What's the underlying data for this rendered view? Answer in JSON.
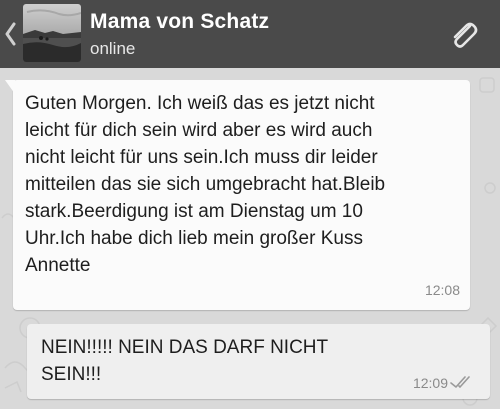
{
  "header": {
    "contact_name": "Mama von Schatz",
    "status": "online",
    "back_icon": "chevron-left-icon",
    "attach_icon": "paperclip-icon",
    "background_color": "#4a4a4a"
  },
  "messages": [
    {
      "direction": "incoming",
      "text": "Guten Morgen. Ich weiß das es jetzt nicht leicht für dich sein wird aber es wird auch nicht leicht für uns sein.Ich muss dir leider mitteilen das sie sich umgebracht hat.Bleib stark.Beerdigung ist am Dienstag um 10 Uhr.Ich habe dich lieb mein großer Kuss Annette",
      "time": "12:08"
    },
    {
      "direction": "outgoing",
      "text": "NEIN!!!!! NEIN DAS DARF NICHT SEIN!!!",
      "time": "12:09",
      "status_icon": "double-check-icon"
    }
  ]
}
